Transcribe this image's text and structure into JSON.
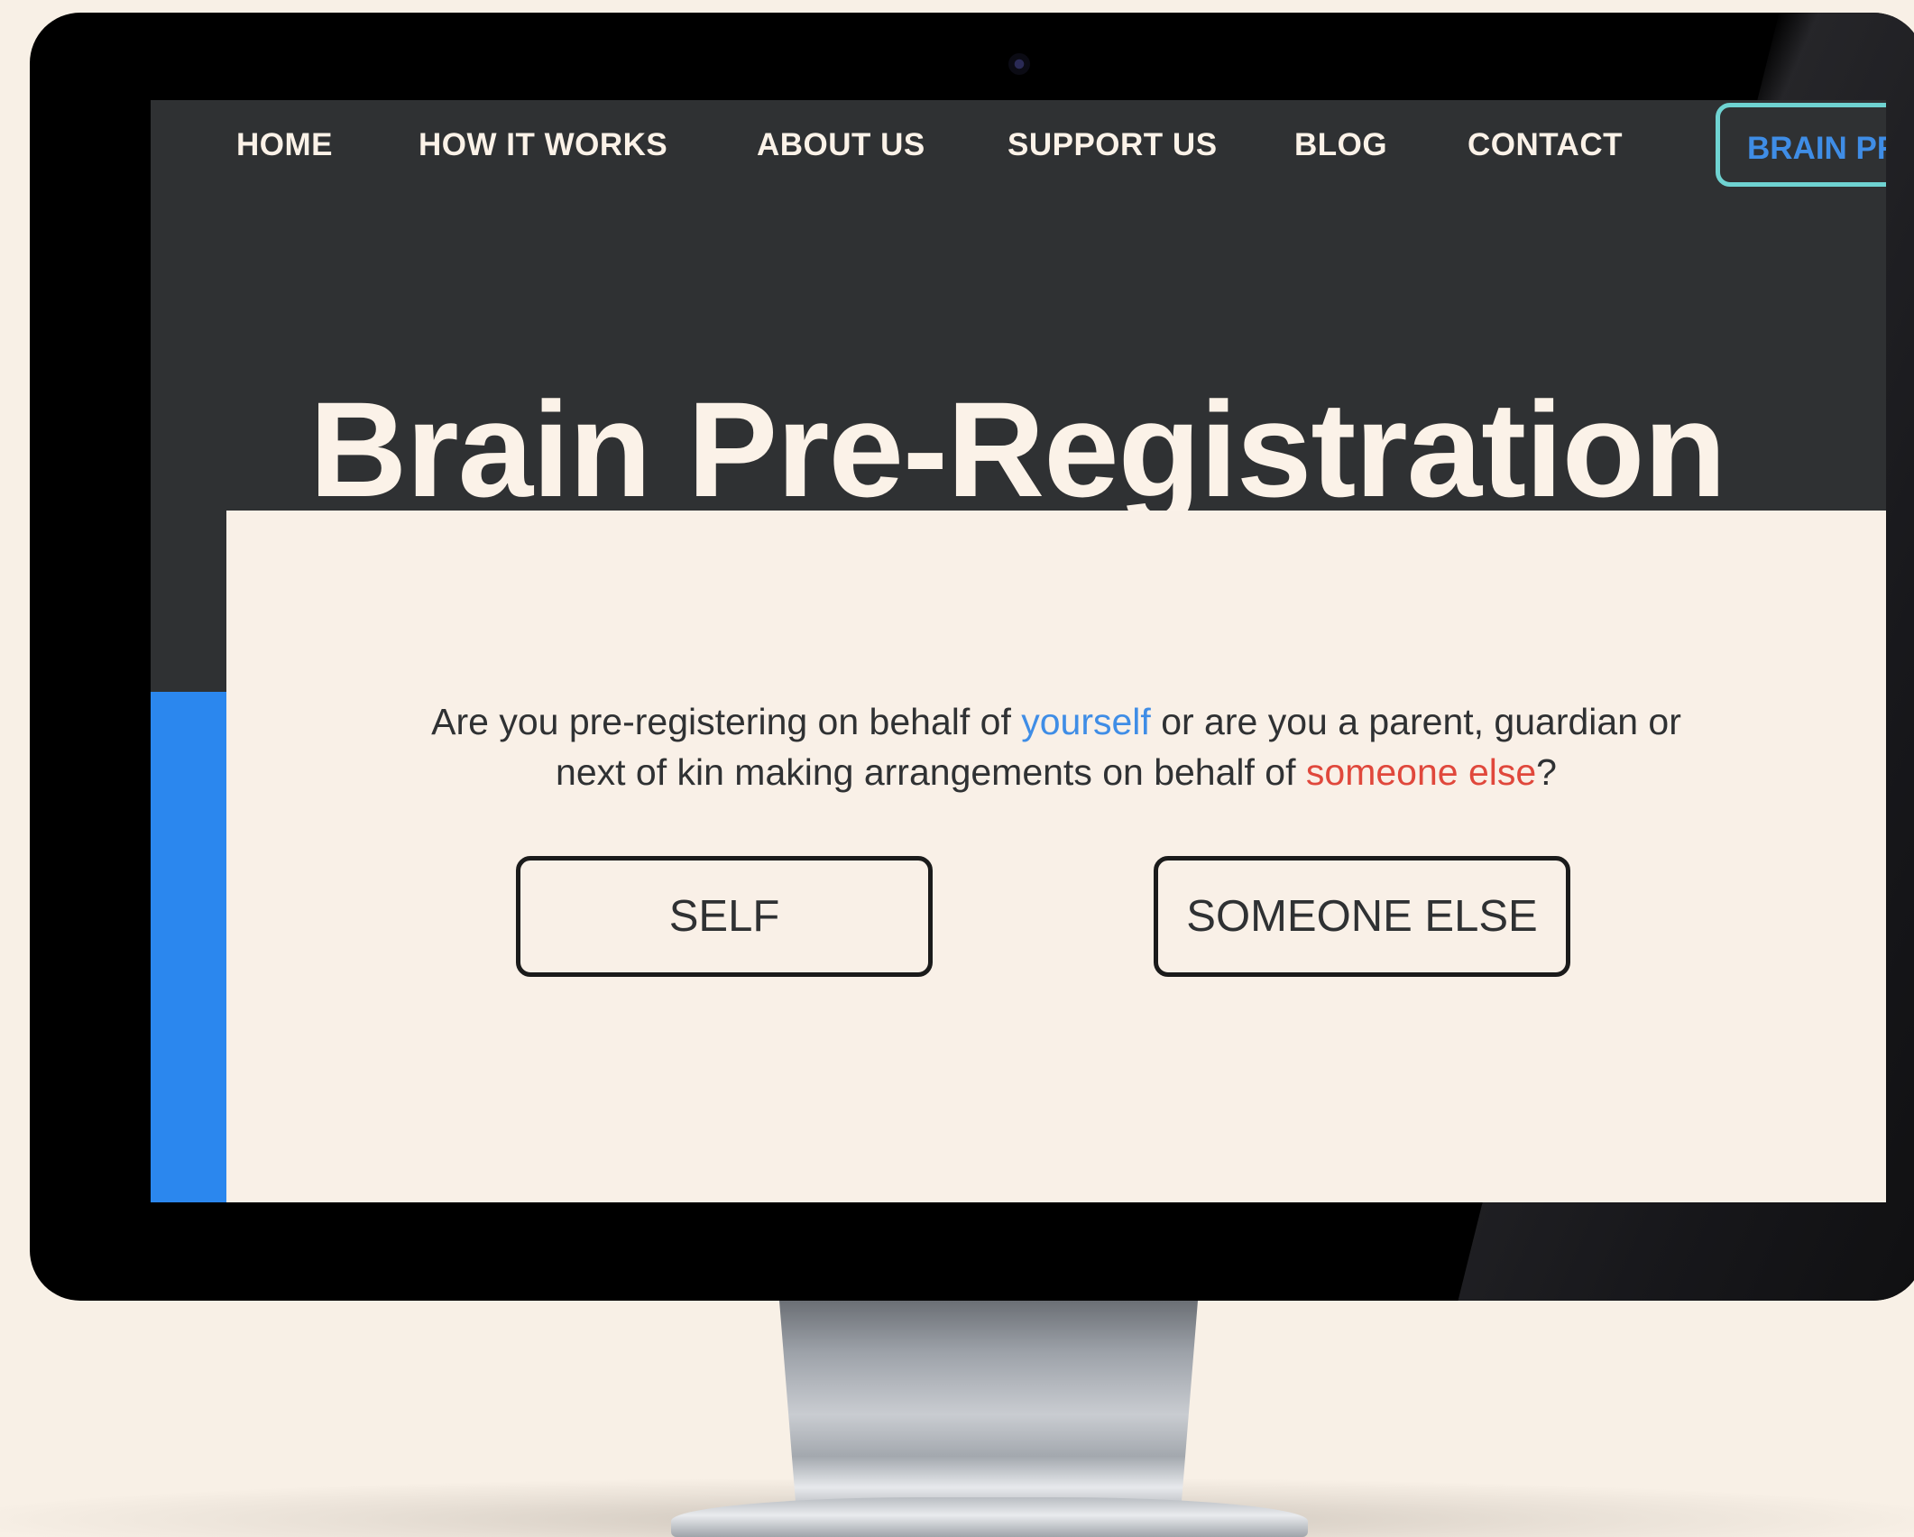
{
  "nav": {
    "items": [
      {
        "label": "HOME"
      },
      {
        "label": "HOW IT WORKS"
      },
      {
        "label": "ABOUT US"
      },
      {
        "label": "SUPPORT US"
      },
      {
        "label": "BLOG"
      },
      {
        "label": "CONTACT"
      }
    ],
    "cta_label": "BRAIN PR"
  },
  "hero": {
    "title": "Brain Pre-Registration"
  },
  "question": {
    "part1": "Are you pre-registering on behalf of ",
    "self_word": "yourself",
    "part2": " or are you a parent, guardian or next of kin making arrangements on behalf of ",
    "else_word": "someone else",
    "part3": "?"
  },
  "choices": {
    "self_label": "SELF",
    "else_label": "SOMEONE ELSE"
  },
  "colors": {
    "page_background": "#f8f0e6",
    "header_background": "#2f3133",
    "accent_blue": "#3f8de6",
    "accent_red": "#e0483c",
    "cta_border": "#6fd3d2",
    "side_bar_blue": "#2b87ee"
  }
}
